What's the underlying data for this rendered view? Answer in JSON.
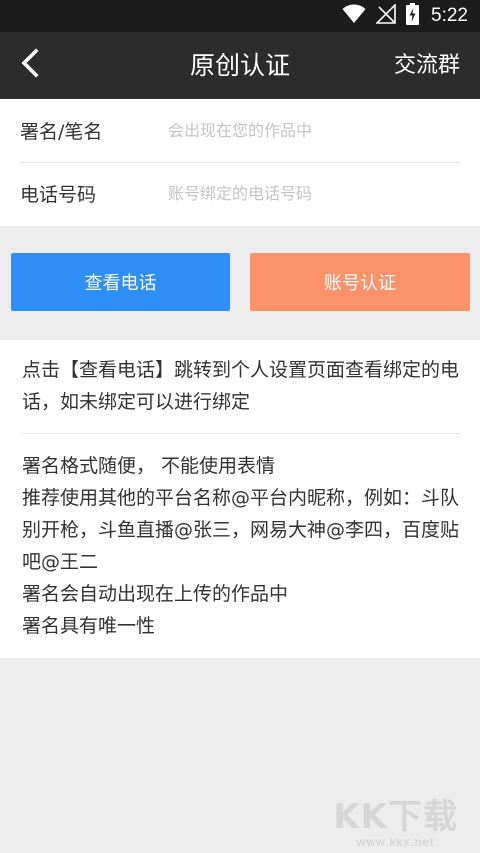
{
  "statusbar": {
    "time": "5:22",
    "icons": [
      "wifi-icon",
      "signal-off-icon",
      "battery-charging-icon"
    ]
  },
  "appbar": {
    "title": "原创认证",
    "action_label": "交流群",
    "back_icon": "chevron-left-icon"
  },
  "form": {
    "signature": {
      "label": "署名/笔名",
      "value": "",
      "placeholder": "会出现在您的作品中"
    },
    "phone": {
      "label": "电话号码",
      "value": "",
      "placeholder": "账号绑定的电话号码"
    }
  },
  "buttons": {
    "view_phone": "查看电话",
    "verify_account": "账号认证"
  },
  "colors": {
    "view_phone_button": "#2d8ff7",
    "verify_account_button": "#fb9269",
    "appbar": "#2c2c2c",
    "statusbar": "#1c1c1c",
    "background": "#ececec"
  },
  "info": {
    "tip": "点击【查看电话】跳转到个人设置页面查看绑定的电话，如未绑定可以进行绑定",
    "rules": [
      "署名格式随便， 不能使用表情",
      "推荐使用其他的平台名称@平台内昵称，例如：斗队别开枪，斗鱼直播@张三，网易大神@李四，百度贴吧@王二",
      "署名会自动出现在上传的作品中",
      "署名具有唯一性"
    ]
  },
  "watermark": {
    "logo": "KK下载",
    "url": "www.kkx.net"
  }
}
